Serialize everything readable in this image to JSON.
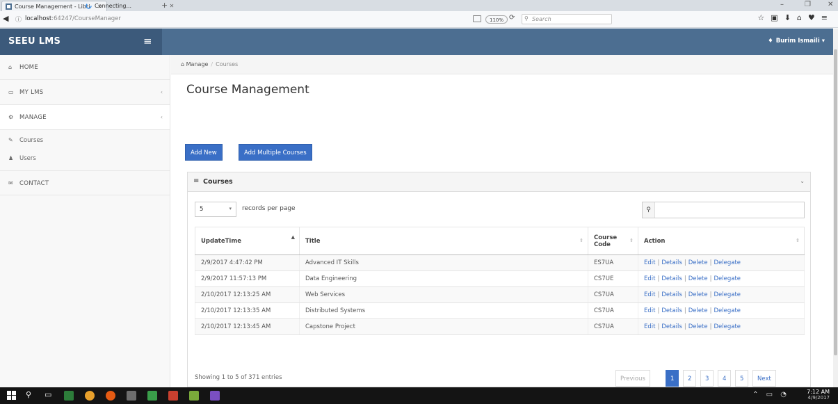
{
  "browser": {
    "tabs": [
      {
        "title": "Course Management - Libri",
        "active": true
      },
      {
        "title": "Connecting...",
        "active": false
      }
    ],
    "url_host": "localhost",
    "url_path": ":64247/CourseManager",
    "zoom": "110%",
    "search_placeholder": "Search"
  },
  "app": {
    "brand": "SEEU LMS",
    "user": "Burim Ismaili",
    "colors": {
      "topbar": "#4c6e91",
      "brand": "#3c5a7b",
      "primary": "#3a6fc6"
    }
  },
  "sidebar": {
    "items": [
      {
        "label": "HOME",
        "icon": "home-icon"
      },
      {
        "label": "MY LMS",
        "icon": "folder-icon"
      },
      {
        "label": "MANAGE",
        "icon": "cogs-icon"
      }
    ],
    "sub_items": [
      {
        "label": "Courses",
        "icon": "edit-icon"
      },
      {
        "label": "Users",
        "icon": "user-icon"
      }
    ],
    "contact": {
      "label": "CONTACT",
      "icon": "envelope-icon"
    }
  },
  "breadcrumb": {
    "root": "Manage",
    "current": "Courses"
  },
  "page_title": "Course Management",
  "buttons": {
    "add_new": "Add New",
    "add_multiple": "Add Multiple Courses"
  },
  "panel": {
    "title": "Courses",
    "records_value": "5",
    "records_label": "records per page",
    "columns": [
      "UpdateTime",
      "Title",
      "Course Code",
      "Action"
    ],
    "rows": [
      {
        "time": "2/9/2017 4:47:42 PM",
        "title": "Advanced IT Skills",
        "code": "ES7UA"
      },
      {
        "time": "2/9/2017 11:57:13 PM",
        "title": "Data Engineering",
        "code": "CS7UE"
      },
      {
        "time": "2/10/2017 12:13:25 AM",
        "title": "Web Services",
        "code": "CS7UA"
      },
      {
        "time": "2/10/2017 12:13:35 AM",
        "title": "Distributed Systems",
        "code": "CS7UA"
      },
      {
        "time": "2/10/2017 12:13:45 AM",
        "title": "Capstone Project",
        "code": "CS7UA"
      }
    ],
    "actions": [
      "Edit",
      "Details",
      "Delete",
      "Delegate"
    ],
    "info": "Showing 1 to 5 of 371 entries",
    "pager": {
      "previous": "Previous",
      "pages": [
        "1",
        "2",
        "3",
        "4",
        "5"
      ],
      "next": "Next"
    }
  },
  "taskbar": {
    "time": "7:12 AM",
    "date": "4/9/2017"
  }
}
